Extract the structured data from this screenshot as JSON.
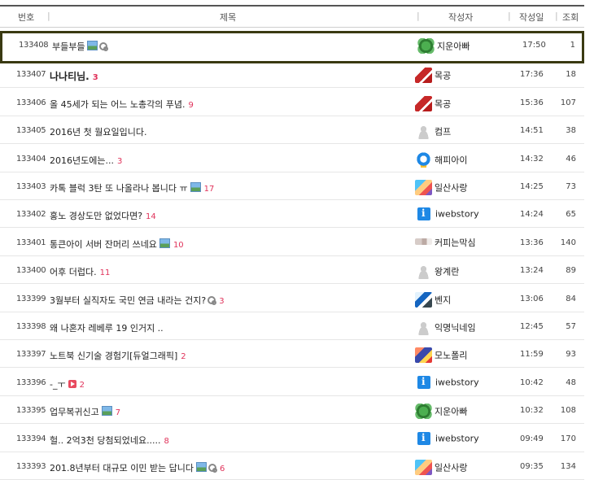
{
  "header": {
    "num": "번호",
    "title": "제목",
    "author": "작성자",
    "date": "작성일",
    "views": "조회"
  },
  "rows": [
    {
      "num": "133408",
      "title": "부들부들",
      "comments": "",
      "author": "지운아빠",
      "avatar": "clover-avatar",
      "time": "17:50",
      "views": "1",
      "icons": [
        "image-icon",
        "link-icon"
      ],
      "bold": false
    },
    {
      "num": "133407",
      "title": "나나티님.",
      "comments": "3",
      "author": "목공",
      "avatar": "red-avatar",
      "time": "17:36",
      "views": "18",
      "icons": [],
      "bold": true
    },
    {
      "num": "133406",
      "title": "올 45세가 되는 어느 노총각의 푸념.",
      "comments": "9",
      "author": "목공",
      "avatar": "red-avatar",
      "time": "15:36",
      "views": "107",
      "icons": [],
      "bold": false
    },
    {
      "num": "133405",
      "title": "2016년 첫 월요일입니다.",
      "comments": "",
      "author": "컴프",
      "avatar": "person-avatar",
      "time": "14:51",
      "views": "38",
      "icons": [],
      "bold": false
    },
    {
      "num": "133404",
      "title": "2016년도에는...",
      "comments": "3",
      "author": "해피아이",
      "avatar": "duck-avatar",
      "time": "14:32",
      "views": "46",
      "icons": [],
      "bold": false
    },
    {
      "num": "133403",
      "title": "카톡 블럭 3탄 또 나올라나 봅니다 ㅠ",
      "comments": "17",
      "author": "일산사랑",
      "avatar": "mix-avatar",
      "time": "14:25",
      "views": "73",
      "icons": [
        "image-icon"
      ],
      "bold": false
    },
    {
      "num": "133402",
      "title": "홍노 경상도만 없었다면?",
      "comments": "14",
      "author": "iwebstory",
      "avatar": "info-avatar",
      "time": "14:24",
      "views": "65",
      "icons": [],
      "bold": false
    },
    {
      "num": "133401",
      "title": "통큰아이 서버 잔머리 쓰네요",
      "comments": "10",
      "author": "커피는막심",
      "avatar": "coffee-avatar",
      "time": "13:36",
      "views": "140",
      "icons": [
        "image-icon"
      ],
      "bold": false
    },
    {
      "num": "133400",
      "title": "어후 더럽다.",
      "comments": "11",
      "author": "왕계란",
      "avatar": "person-avatar",
      "time": "13:24",
      "views": "89",
      "icons": [],
      "bold": false
    },
    {
      "num": "133399",
      "title": "3월부터 실직자도 국민 연금 내라는 건지?",
      "comments": "3",
      "author": "벤지",
      "avatar": "dog-avatar",
      "time": "13:06",
      "views": "84",
      "icons": [
        "link-icon"
      ],
      "bold": false
    },
    {
      "num": "133398",
      "title": "왜 나혼자 레베루 19 인거지 ..",
      "comments": "",
      "author": "익명닉네임",
      "avatar": "person-avatar",
      "time": "12:45",
      "views": "57",
      "icons": [],
      "bold": false
    },
    {
      "num": "133397",
      "title": "노트북 신기술 경험기[듀얼그래픽]",
      "comments": "2",
      "author": "모노폴리",
      "avatar": "mono-avatar",
      "time": "11:59",
      "views": "93",
      "icons": [],
      "bold": false
    },
    {
      "num": "133396",
      "title": "-_ㅜ",
      "comments": "2",
      "author": "iwebstory",
      "avatar": "info-avatar",
      "time": "10:42",
      "views": "48",
      "icons": [
        "video-icon"
      ],
      "bold": false
    },
    {
      "num": "133395",
      "title": "업무복귀신고",
      "comments": "7",
      "author": "지운아빠",
      "avatar": "clover-avatar",
      "time": "10:32",
      "views": "108",
      "icons": [
        "image-icon"
      ],
      "bold": false
    },
    {
      "num": "133394",
      "title": "헐.. 2억3천 당첨되었네요.....",
      "comments": "8",
      "author": "iwebstory",
      "avatar": "info-avatar",
      "time": "09:49",
      "views": "170",
      "icons": [],
      "bold": false
    },
    {
      "num": "133393",
      "title": "201.8년부터 대규모 이민 받는 답니다",
      "comments": "6",
      "author": "일산사랑",
      "avatar": "mix-avatar",
      "time": "09:35",
      "views": "134",
      "icons": [
        "image-icon",
        "link-icon"
      ],
      "bold": false
    }
  ]
}
